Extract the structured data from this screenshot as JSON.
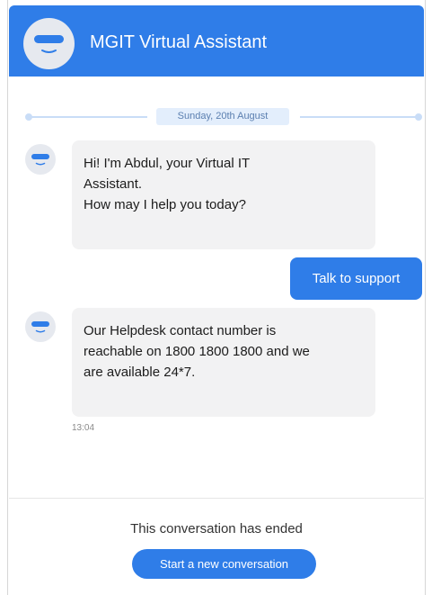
{
  "header": {
    "title": "MGIT Virtual Assistant",
    "avatar_icon": "bot-face-icon"
  },
  "chat": {
    "date": "Sunday, 20th August",
    "messages": [
      {
        "sender": "bot",
        "lines": [
          "Hi! I'm Abdul, your Virtual IT",
          "Assistant.",
          "How may I help you today?"
        ]
      },
      {
        "sender": "user",
        "text": "Talk to support"
      },
      {
        "sender": "bot",
        "lines": [
          "Our Helpdesk contact number is",
          "reachable on 1800 1800 1800 and we",
          "are available 24*7."
        ],
        "time": "13:04"
      }
    ]
  },
  "footer": {
    "ended_text": "This conversation has ended",
    "restart_label": "Start a new conversation"
  },
  "colors": {
    "accent": "#2f7de8",
    "bot_bubble": "#f2f2f3",
    "date_pill": "#e3eefc"
  }
}
